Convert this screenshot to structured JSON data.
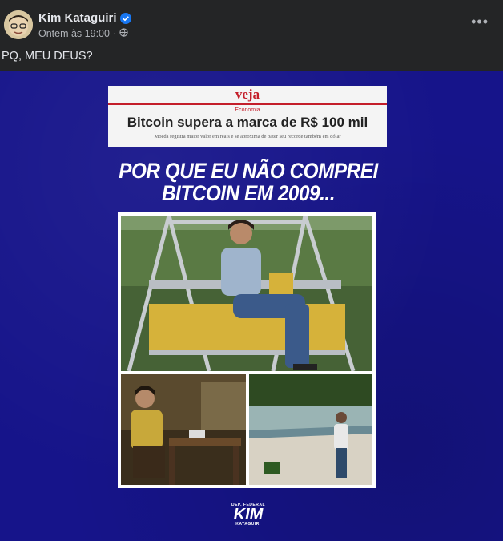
{
  "post": {
    "author": "Kim Kataguiri",
    "timestamp": "Ontem às 19:00",
    "separator": "·",
    "privacy_icon": "globe-icon",
    "verified_icon": "verified-badge-icon",
    "more_label": "•••",
    "caption": "PQ, MEU DEUS?"
  },
  "image": {
    "news": {
      "brand": "veja",
      "section": "Economia",
      "title": "Bitcoin supera a marca de R$ 100 mil",
      "subtitle": "Moeda registra maior valor em reais e se aproxima de bater seu recorde também em dólar"
    },
    "headline_line1": "POR QUE EU NÃO COMPREI",
    "headline_line2": "BITCOIN EM 2009...",
    "footer": {
      "dep": "DEP. FEDERAL",
      "name": "KIM",
      "sub": "KATAGUIRI"
    }
  },
  "colors": {
    "background": "#242526",
    "image_bg": "#16148a",
    "veja_red": "#c41e2a",
    "verified_blue": "#1877f2"
  }
}
